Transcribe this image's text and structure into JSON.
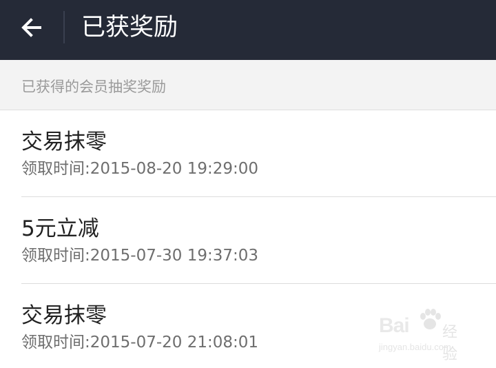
{
  "colors": {
    "topbar_bg": "#252a37",
    "section_bg": "#f3f3f3",
    "title_text": "#ffffff",
    "item_title": "#222222",
    "item_time": "#6e6e6e",
    "section_text": "#9a9a9a"
  },
  "header": {
    "back_icon": "back-arrow-icon",
    "title": "已获奖励"
  },
  "section": {
    "label": "已获得的会员抽奖奖励"
  },
  "rewards": [
    {
      "name": "交易抹零",
      "time": "领取时间:2015-08-20 19:29:00"
    },
    {
      "name": "5元立减",
      "time": "领取时间:2015-07-30 19:37:03"
    },
    {
      "name": "交易抹零",
      "time": "领取时间:2015-07-20 21:08:01"
    }
  ],
  "watermark": {
    "brand": "Bai",
    "sub": "经验",
    "url": "jingyan.baidu.com"
  }
}
